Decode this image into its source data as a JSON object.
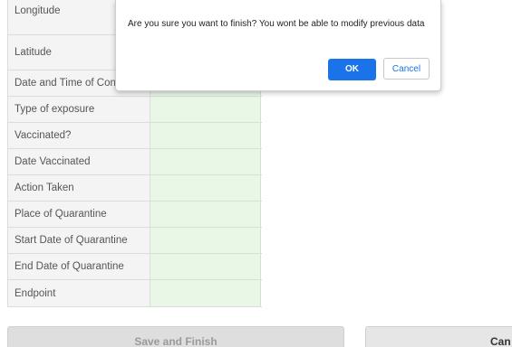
{
  "form": {
    "rows": [
      {
        "label": "Longitude"
      },
      {
        "label": "Latitude"
      },
      {
        "label": "Date and Time of Cont"
      },
      {
        "label": "Type of exposure"
      },
      {
        "label": "Vaccinated?"
      },
      {
        "label": "Date Vaccinated"
      },
      {
        "label": "Action Taken"
      },
      {
        "label": "Place of Quarantine"
      },
      {
        "label": "Start Date of Quarantine"
      },
      {
        "label": "End Date of Quarantine"
      },
      {
        "label": "Endpoint"
      }
    ]
  },
  "buttons": {
    "save_finish": "Save and Finish",
    "cancel": "Can"
  },
  "dialog": {
    "message": "Are you sure you want to finish? You wont be able to modify previous data",
    "ok_label": "OK",
    "cancel_label": "Cancel"
  },
  "colors": {
    "value_cell_bg": "#e8f7e6",
    "label_cell_bg": "#f4f4f4",
    "ok_button": "#1a73e8"
  }
}
